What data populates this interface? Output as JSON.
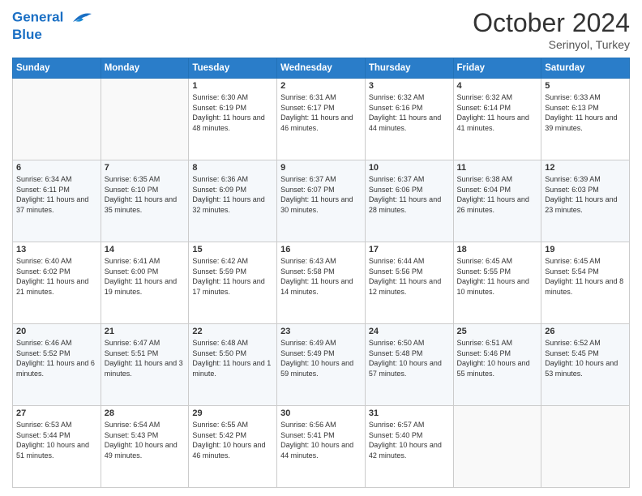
{
  "header": {
    "logo_line1": "General",
    "logo_line2": "Blue",
    "month": "October 2024",
    "location": "Serinyol, Turkey"
  },
  "weekdays": [
    "Sunday",
    "Monday",
    "Tuesday",
    "Wednesday",
    "Thursday",
    "Friday",
    "Saturday"
  ],
  "weeks": [
    [
      {
        "day": "",
        "info": ""
      },
      {
        "day": "",
        "info": ""
      },
      {
        "day": "1",
        "info": "Sunrise: 6:30 AM\nSunset: 6:19 PM\nDaylight: 11 hours and 48 minutes."
      },
      {
        "day": "2",
        "info": "Sunrise: 6:31 AM\nSunset: 6:17 PM\nDaylight: 11 hours and 46 minutes."
      },
      {
        "day": "3",
        "info": "Sunrise: 6:32 AM\nSunset: 6:16 PM\nDaylight: 11 hours and 44 minutes."
      },
      {
        "day": "4",
        "info": "Sunrise: 6:32 AM\nSunset: 6:14 PM\nDaylight: 11 hours and 41 minutes."
      },
      {
        "day": "5",
        "info": "Sunrise: 6:33 AM\nSunset: 6:13 PM\nDaylight: 11 hours and 39 minutes."
      }
    ],
    [
      {
        "day": "6",
        "info": "Sunrise: 6:34 AM\nSunset: 6:11 PM\nDaylight: 11 hours and 37 minutes."
      },
      {
        "day": "7",
        "info": "Sunrise: 6:35 AM\nSunset: 6:10 PM\nDaylight: 11 hours and 35 minutes."
      },
      {
        "day": "8",
        "info": "Sunrise: 6:36 AM\nSunset: 6:09 PM\nDaylight: 11 hours and 32 minutes."
      },
      {
        "day": "9",
        "info": "Sunrise: 6:37 AM\nSunset: 6:07 PM\nDaylight: 11 hours and 30 minutes."
      },
      {
        "day": "10",
        "info": "Sunrise: 6:37 AM\nSunset: 6:06 PM\nDaylight: 11 hours and 28 minutes."
      },
      {
        "day": "11",
        "info": "Sunrise: 6:38 AM\nSunset: 6:04 PM\nDaylight: 11 hours and 26 minutes."
      },
      {
        "day": "12",
        "info": "Sunrise: 6:39 AM\nSunset: 6:03 PM\nDaylight: 11 hours and 23 minutes."
      }
    ],
    [
      {
        "day": "13",
        "info": "Sunrise: 6:40 AM\nSunset: 6:02 PM\nDaylight: 11 hours and 21 minutes."
      },
      {
        "day": "14",
        "info": "Sunrise: 6:41 AM\nSunset: 6:00 PM\nDaylight: 11 hours and 19 minutes."
      },
      {
        "day": "15",
        "info": "Sunrise: 6:42 AM\nSunset: 5:59 PM\nDaylight: 11 hours and 17 minutes."
      },
      {
        "day": "16",
        "info": "Sunrise: 6:43 AM\nSunset: 5:58 PM\nDaylight: 11 hours and 14 minutes."
      },
      {
        "day": "17",
        "info": "Sunrise: 6:44 AM\nSunset: 5:56 PM\nDaylight: 11 hours and 12 minutes."
      },
      {
        "day": "18",
        "info": "Sunrise: 6:45 AM\nSunset: 5:55 PM\nDaylight: 11 hours and 10 minutes."
      },
      {
        "day": "19",
        "info": "Sunrise: 6:45 AM\nSunset: 5:54 PM\nDaylight: 11 hours and 8 minutes."
      }
    ],
    [
      {
        "day": "20",
        "info": "Sunrise: 6:46 AM\nSunset: 5:52 PM\nDaylight: 11 hours and 6 minutes."
      },
      {
        "day": "21",
        "info": "Sunrise: 6:47 AM\nSunset: 5:51 PM\nDaylight: 11 hours and 3 minutes."
      },
      {
        "day": "22",
        "info": "Sunrise: 6:48 AM\nSunset: 5:50 PM\nDaylight: 11 hours and 1 minute."
      },
      {
        "day": "23",
        "info": "Sunrise: 6:49 AM\nSunset: 5:49 PM\nDaylight: 10 hours and 59 minutes."
      },
      {
        "day": "24",
        "info": "Sunrise: 6:50 AM\nSunset: 5:48 PM\nDaylight: 10 hours and 57 minutes."
      },
      {
        "day": "25",
        "info": "Sunrise: 6:51 AM\nSunset: 5:46 PM\nDaylight: 10 hours and 55 minutes."
      },
      {
        "day": "26",
        "info": "Sunrise: 6:52 AM\nSunset: 5:45 PM\nDaylight: 10 hours and 53 minutes."
      }
    ],
    [
      {
        "day": "27",
        "info": "Sunrise: 6:53 AM\nSunset: 5:44 PM\nDaylight: 10 hours and 51 minutes."
      },
      {
        "day": "28",
        "info": "Sunrise: 6:54 AM\nSunset: 5:43 PM\nDaylight: 10 hours and 49 minutes."
      },
      {
        "day": "29",
        "info": "Sunrise: 6:55 AM\nSunset: 5:42 PM\nDaylight: 10 hours and 46 minutes."
      },
      {
        "day": "30",
        "info": "Sunrise: 6:56 AM\nSunset: 5:41 PM\nDaylight: 10 hours and 44 minutes."
      },
      {
        "day": "31",
        "info": "Sunrise: 6:57 AM\nSunset: 5:40 PM\nDaylight: 10 hours and 42 minutes."
      },
      {
        "day": "",
        "info": ""
      },
      {
        "day": "",
        "info": ""
      }
    ]
  ]
}
